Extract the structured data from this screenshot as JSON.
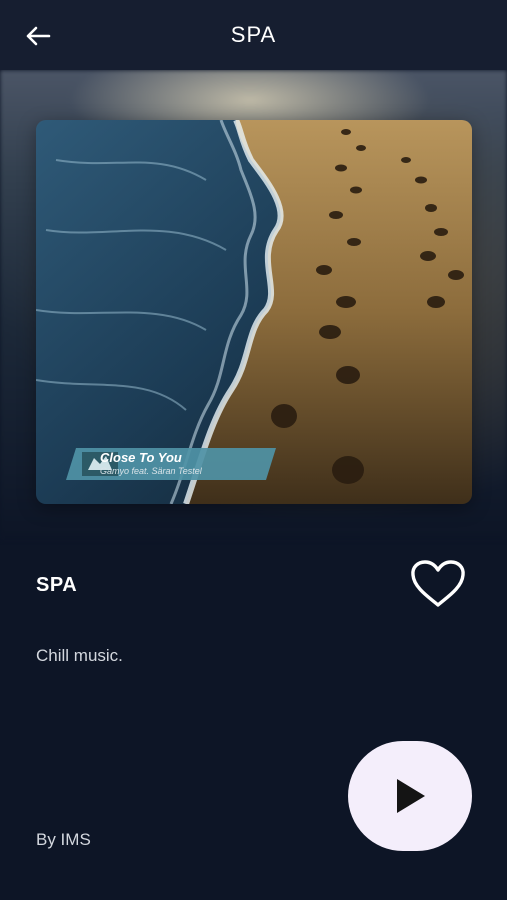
{
  "header": {
    "title": "SPA",
    "back_icon": "arrow-left-icon"
  },
  "album": {
    "banner_title": "Close To You",
    "banner_subtitle": "Gamyo feat. Säran Testel"
  },
  "playlist": {
    "name": "SPA",
    "description": "Chill music.",
    "author": "By IMS",
    "favorite_icon": "heart-outline-icon",
    "play_icon": "play-icon"
  },
  "colors": {
    "background": "#0d1526",
    "header": "#161e30",
    "play_button": "#f4eefb",
    "text_primary": "#ffffff",
    "text_secondary": "#d3d7de"
  }
}
